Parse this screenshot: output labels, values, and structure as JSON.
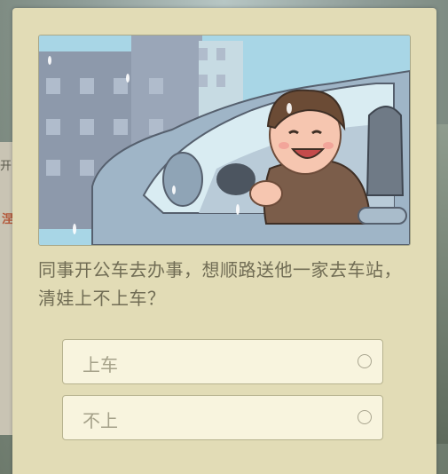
{
  "background": {
    "left_text": "开",
    "left_red_text": "涅"
  },
  "dialog": {
    "illustration_icon": "man-driving-car-illustration",
    "question": "同事开公车去办事，想顺路送他一家去车站，清娃上不上车？",
    "options": [
      {
        "label": "上车",
        "selected": false
      },
      {
        "label": "不上",
        "selected": false
      }
    ]
  },
  "colors": {
    "card_bg": "#e2dcb6",
    "option_bg": "#f8f4de",
    "question_text": "#716d55",
    "option_text": "#a5a189"
  }
}
